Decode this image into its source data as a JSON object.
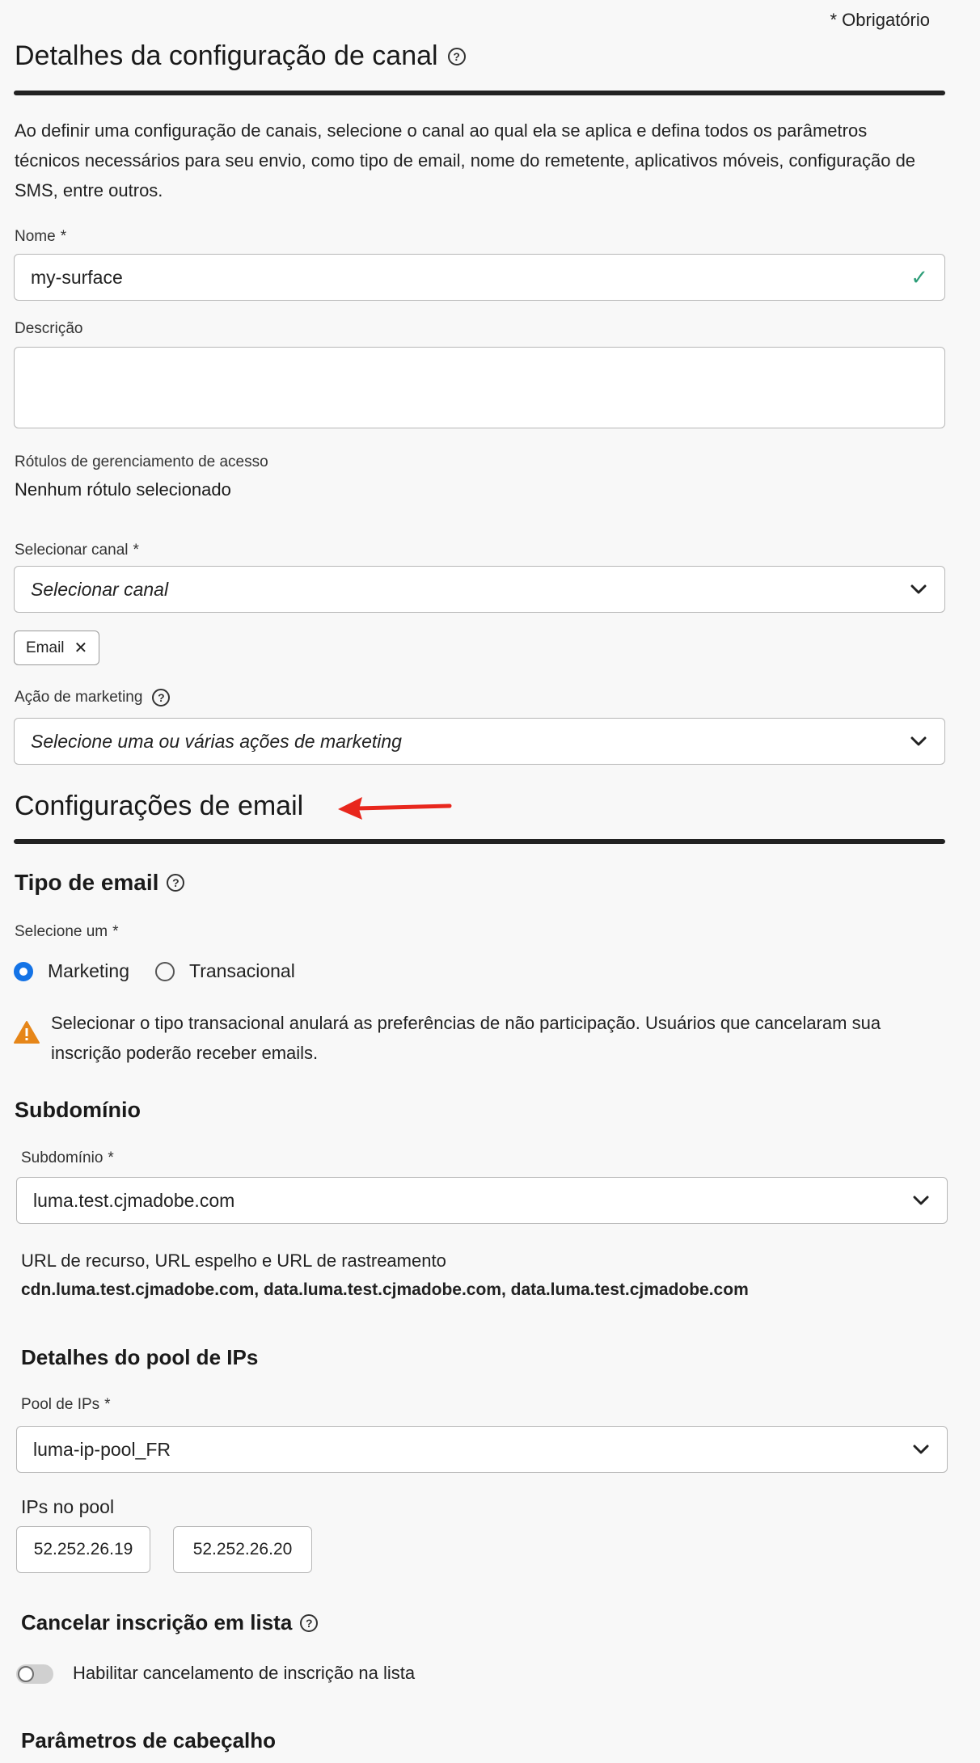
{
  "required_note": "* Obrigatório",
  "channel_config": {
    "title": "Detalhes da configuração de canal",
    "description": "Ao definir uma configuração de canais, selecione o canal ao qual ela se aplica e defina todos os parâmetros técnicos necessários para seu envio, como tipo de email, nome do remetente, aplicativos móveis, configuração de SMS, entre outros.",
    "name_label": "Nome",
    "name_value": "my-surface",
    "description_label": "Descrição",
    "description_value": "",
    "access_labels_label": "Rótulos de gerenciamento de acesso",
    "access_labels_value": "Nenhum rótulo selecionado",
    "channel_label": "Selecionar canal",
    "channel_placeholder": "Selecionar canal",
    "channel_tag": "Email",
    "marketing_action_label": "Ação de marketing",
    "marketing_action_placeholder": "Selecione uma ou várias ações de marketing"
  },
  "email_settings": {
    "title": "Configurações de email",
    "email_type": {
      "title": "Tipo de email",
      "select_label": "Selecione um",
      "options": [
        "Marketing",
        "Transacional"
      ],
      "selected": "Marketing",
      "warning": "Selecionar o tipo transacional anulará as preferências de não participação. Usuários que cancelaram sua inscrição poderão receber emails."
    },
    "subdomain": {
      "title": "Subdomínio",
      "label": "Subdomínio",
      "value": "luma.test.cjmadobe.com",
      "urls_label": "URL de recurso, URL espelho e URL de rastreamento",
      "urls_value": "cdn.luma.test.cjmadobe.com, data.luma.test.cjmadobe.com, data.luma.test.cjmadobe.com"
    },
    "ip_pool": {
      "title": "Detalhes do pool de IPs",
      "label": "Pool de IPs",
      "value": "luma-ip-pool_FR",
      "ips_label": "IPs no pool",
      "ips": [
        "52.252.26.19",
        "52.252.26.20"
      ]
    },
    "list_unsubscribe": {
      "title": "Cancelar inscrição em lista",
      "toggle_label": "Habilitar cancelamento de inscrição na lista",
      "enabled": false
    },
    "header_params": {
      "title": "Parâmetros de cabeçalho"
    }
  },
  "colors": {
    "accent": "#1473e6",
    "success": "#2d9d78",
    "warning": "#e68619",
    "annotation_arrow": "#e8271d"
  }
}
